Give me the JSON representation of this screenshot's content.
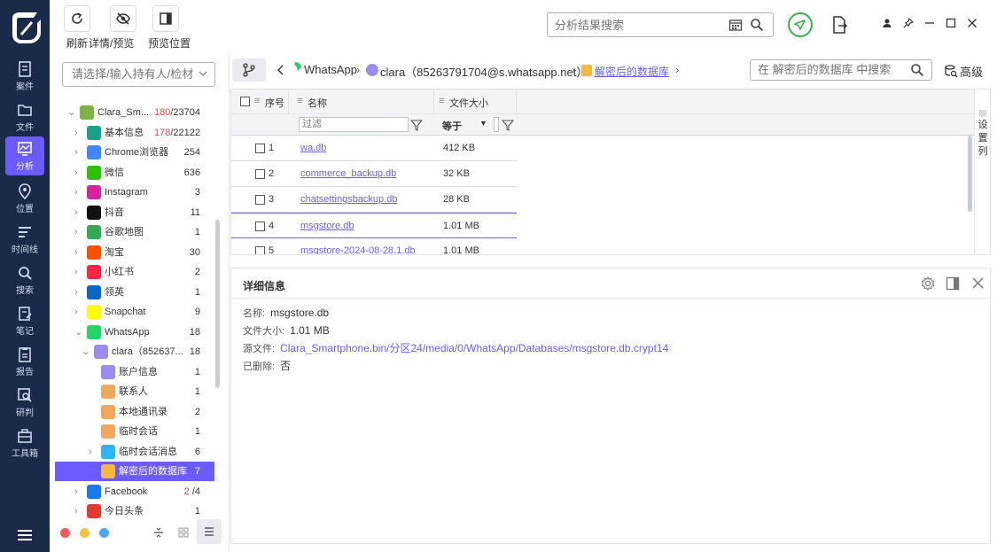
{
  "nav": {
    "items": [
      {
        "label": "案件",
        "icon": "case-icon"
      },
      {
        "label": "文件",
        "icon": "folder-icon"
      },
      {
        "label": "分析",
        "icon": "analysis-icon"
      },
      {
        "label": "位置",
        "icon": "location-pin-icon"
      },
      {
        "label": "时间线",
        "icon": "timeline-icon"
      },
      {
        "label": "搜索",
        "icon": "search-icon"
      },
      {
        "label": "笔记",
        "icon": "notes-icon"
      },
      {
        "label": "报告",
        "icon": "report-icon"
      },
      {
        "label": "研判",
        "icon": "judge-icon"
      },
      {
        "label": "工具箱",
        "icon": "toolbox-icon"
      }
    ],
    "active": "分析"
  },
  "toolbar": {
    "refresh_label": "刷新",
    "details_label": "详情/预览",
    "preview_pos_label": "预览位置",
    "search_placeholder": "分析结果搜索"
  },
  "tree": {
    "search_placeholder": "请选择/输入持有人/检材",
    "rows": [
      {
        "name": "Clara_Sm...",
        "red": "180",
        "count": "/23704",
        "icon": "android-icon",
        "color": "#7cb342"
      },
      {
        "name": "基本信息",
        "red": "178",
        "count": "/22122",
        "icon": "info-icon",
        "color": "#1aa188"
      },
      {
        "name": "Chrome浏览器",
        "red": "",
        "count": "254",
        "icon": "chrome-icon",
        "color": "#4285f4"
      },
      {
        "name": "微信",
        "red": "",
        "count": "636",
        "icon": "wechat-icon",
        "color": "#2dc100"
      },
      {
        "name": "Instagram",
        "red": "",
        "count": "3",
        "icon": "instagram-icon",
        "color": "#d6249f"
      },
      {
        "name": "抖音",
        "red": "",
        "count": "11",
        "icon": "douyin-icon",
        "color": "#111111"
      },
      {
        "name": "谷歌地图",
        "red": "",
        "count": "1",
        "icon": "google-maps-icon",
        "color": "#34a853"
      },
      {
        "name": "淘宝",
        "red": "",
        "count": "30",
        "icon": "taobao-icon",
        "color": "#ff5000"
      },
      {
        "name": "小红书",
        "red": "",
        "count": "2",
        "icon": "xiaohongshu-icon",
        "color": "#ff2442"
      },
      {
        "name": "领英",
        "red": "",
        "count": "1",
        "icon": "linkedin-icon",
        "color": "#0a66c2"
      },
      {
        "name": "Snapchat",
        "red": "",
        "count": "9",
        "icon": "snapchat-icon",
        "color": "#fffc00"
      },
      {
        "name": "WhatsApp",
        "red": "",
        "count": "18",
        "icon": "whatsapp-icon",
        "color": "#25d366"
      },
      {
        "name": "clara（852637...",
        "red": "",
        "count": "18",
        "icon": "user-icon",
        "color": "#9c8cf0"
      },
      {
        "name": "账户信息",
        "red": "",
        "count": "1",
        "icon": "account-icon",
        "color": "#9c8cf0"
      },
      {
        "name": "联系人",
        "red": "",
        "count": "1",
        "icon": "contact-icon",
        "color": "#f0a860"
      },
      {
        "name": "本地通讯录",
        "red": "",
        "count": "2",
        "icon": "addressbook-icon",
        "color": "#f0a860"
      },
      {
        "name": "临时会话",
        "red": "",
        "count": "1",
        "icon": "temp-chat-icon",
        "color": "#f0a860"
      },
      {
        "name": "临时会话消息",
        "red": "",
        "count": "6",
        "icon": "message-bubble-icon",
        "color": "#29b6f6"
      },
      {
        "name": "解密后的数据库",
        "red": "",
        "count": "7",
        "icon": "database-icon",
        "color": "#f5b942"
      },
      {
        "name": "Facebook",
        "red": "2",
        "count": " /4",
        "icon": "facebook-icon",
        "color": "#1877f2"
      },
      {
        "name": "今日头条",
        "red": "",
        "count": "1",
        "icon": "toutiao-icon",
        "color": "#e53935"
      }
    ]
  },
  "breadcrumb": {
    "items": [
      "WhatsApp",
      "clara（85263791704@s.whatsapp.net）",
      "解密后的数据库"
    ],
    "search_placeholder": "在 解密后的数据库 中搜索",
    "advanced_label": "高级"
  },
  "table": {
    "columns": [
      "序号",
      "名称",
      "文件大小"
    ],
    "filter_placeholder": "过滤",
    "size_op": "等于",
    "rows": [
      {
        "num": "1",
        "name": "wa.db",
        "size": "412 KB"
      },
      {
        "num": "2",
        "name": "commerce_backup.db",
        "size": "32 KB"
      },
      {
        "num": "3",
        "name": "chatsettingsbackup.db",
        "size": "28 KB"
      },
      {
        "num": "4",
        "name": "msgstore.db",
        "size": "1.01 MB"
      },
      {
        "num": "5",
        "name": "msgstore-2024-08-28.1.db",
        "size": "1.01 MB"
      }
    ],
    "set_columns_label": "设置列"
  },
  "detail": {
    "title": "详细信息",
    "name_label": "名称:",
    "name_value": "msgstore.db",
    "size_label": "文件大小:",
    "size_value": "1.01 MB",
    "source_label": "源文件:",
    "source_value": "Clara_Smartphone.bin/分区24/media/0/WhatsApp/Databases/msgstore.db.crypt14",
    "deleted_label": "已删除:",
    "deleted_value": "否"
  },
  "colors": {
    "accent": "#6a5cff",
    "nav_bg": "#1c2a4a",
    "send_green": "#35b34a",
    "dot_red": "#f05a5a",
    "dot_yellow": "#f5c342",
    "dot_blue": "#4aa8ee"
  }
}
